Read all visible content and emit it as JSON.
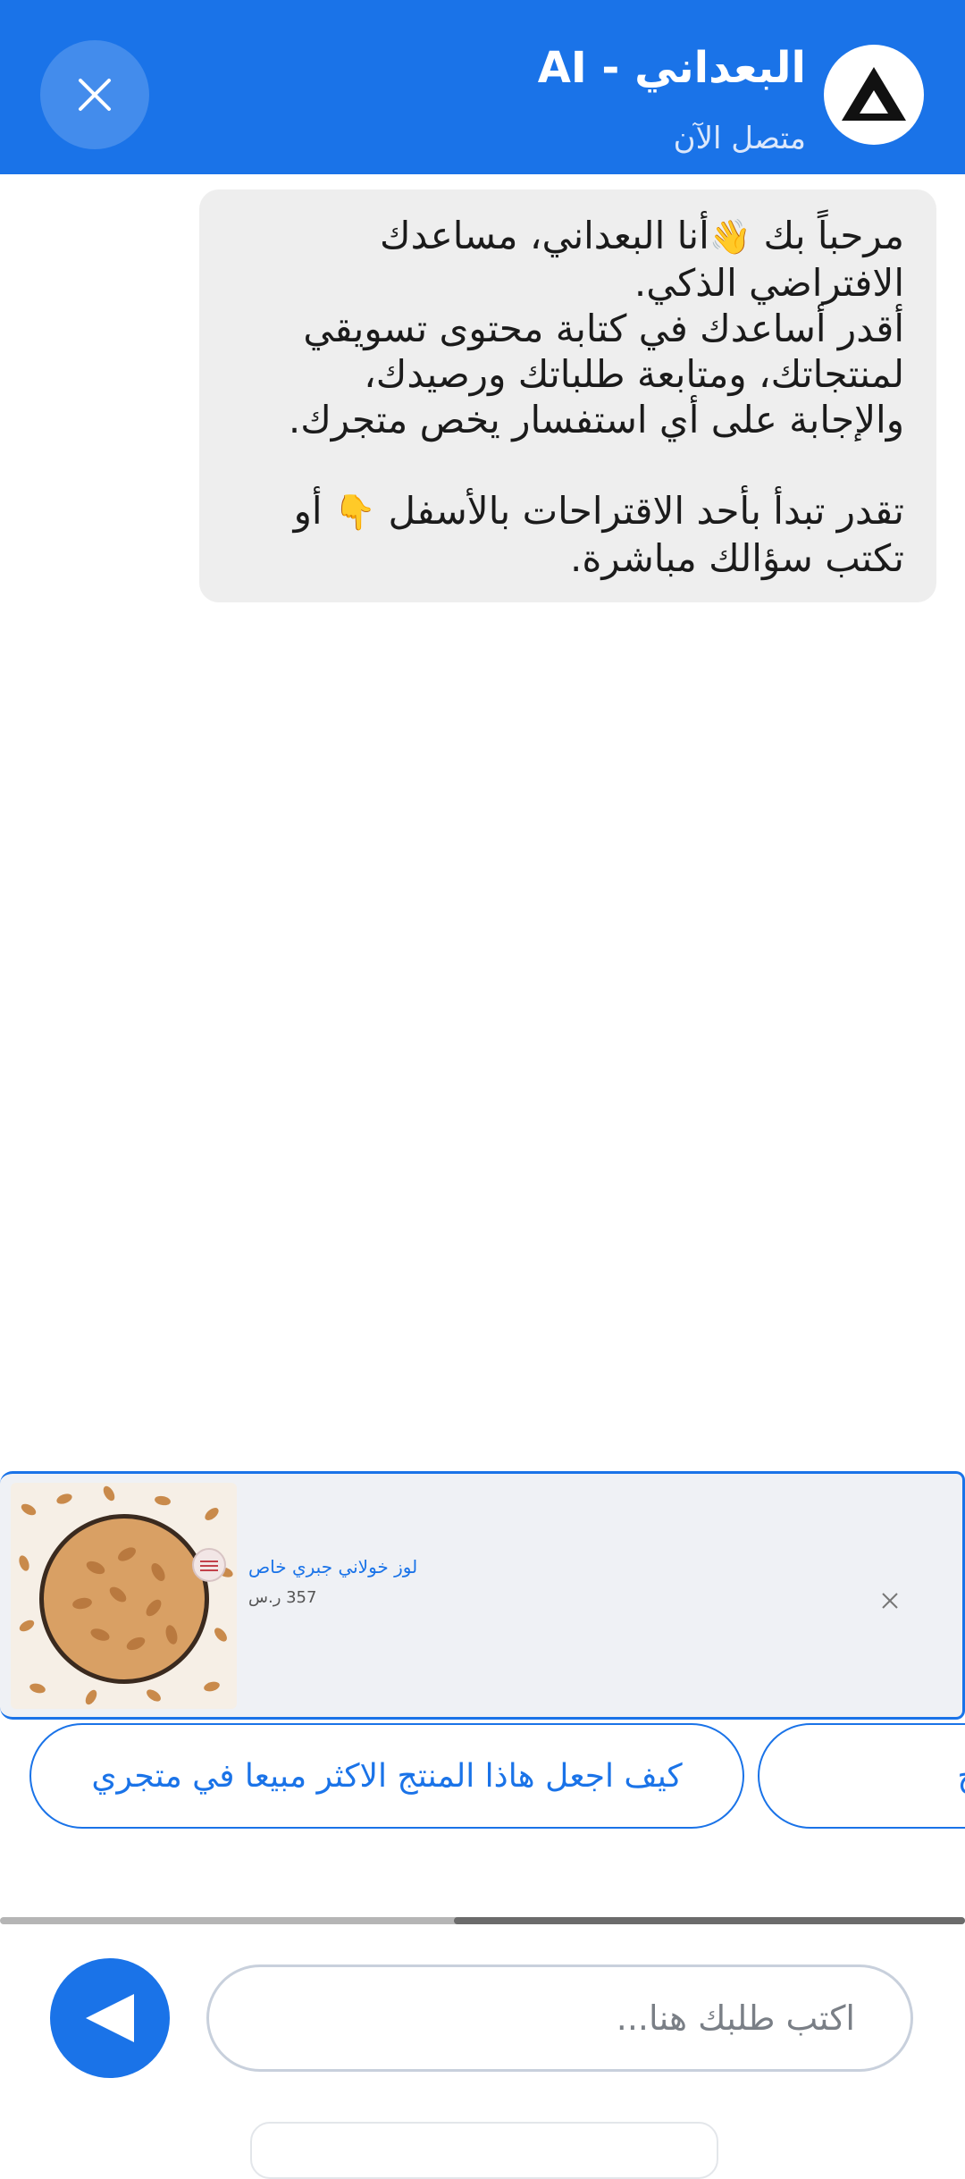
{
  "header": {
    "title": "البعداني - AI",
    "status": "متصل الآن",
    "bg_color": "#1a73e8"
  },
  "icons": {
    "close": "close-icon",
    "logo": "triangle-logo-icon",
    "send": "send-arrow-icon",
    "card_close": "close-icon"
  },
  "chat": {
    "messages": [
      {
        "sender": "assistant",
        "line1_prefix": "مرحباً بك ",
        "line1_emoji": "👋",
        "line1_suffix": "أنا البعداني، مساعدك",
        "line2": "الافتراضي الذكي.",
        "line3": "أقدر أساعدك في كتابة محتوى تسويقي",
        "line4": "لمنتجاتك، ومتابعة طلباتك ورصيدك،",
        "line5": "والإجابة على أي استفسار يخص متجرك.",
        "line6_prefix": "تقدر تبدأ بأحد الاقتراحات بالأسفل ",
        "line6_emoji": "👇",
        "line6_suffix": " أو",
        "line7": "تكتب سؤالك مباشرة."
      }
    ]
  },
  "product": {
    "name": "لوز خولاني جبري خاص",
    "price": "357 ر.س"
  },
  "suggestions": [
    "كيف اجعل هاذا المنتج الاكثر مبيعا في متجري",
    "لهذا المنتج"
  ],
  "composer": {
    "placeholder": "اكتب طلبك هنا...",
    "value": ""
  },
  "scroll": {
    "position_fraction": 0.47,
    "visible_fraction": 0.53
  }
}
